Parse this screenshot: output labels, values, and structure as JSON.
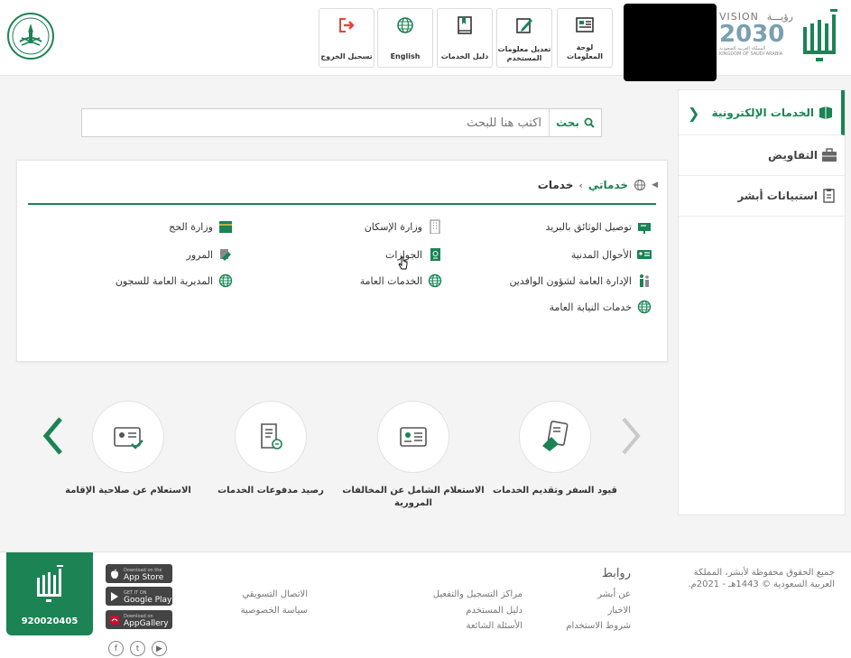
{
  "header": {
    "buttons": [
      {
        "label": "لوحة المعلومات",
        "icon": "dashboard-icon"
      },
      {
        "label": "تعديل معلومات المستخدم",
        "icon": "edit-user-icon"
      },
      {
        "label": "دليل الخدمات",
        "icon": "guide-book-icon"
      },
      {
        "label": "English",
        "icon": "globe-icon"
      },
      {
        "label": "تسجيل الخروج",
        "icon": "logout-icon"
      }
    ],
    "vision": {
      "top": "VISION",
      "arabic": "رؤيـــة",
      "year": "2030",
      "sub1": "المملكة العربية السعودية",
      "sub2": "KINGDOM OF SAUDI ARABIA"
    },
    "logo_text": "أبشر"
  },
  "sidebar": {
    "items": [
      {
        "label": "الخدمات الإلكترونية",
        "icon": "eservices-icon"
      },
      {
        "label": "التفاويض",
        "icon": "briefcase-icon"
      },
      {
        "label": "استبيانات أبشر",
        "icon": "survey-icon"
      }
    ]
  },
  "search": {
    "placeholder": "اكتب هنا للبحث",
    "button": "بحث"
  },
  "breadcrumb": {
    "mine": "خدماتي",
    "current": "خدمات"
  },
  "services": {
    "col1": [
      {
        "label": "توصيل الوثائق بالبريد",
        "icon": "mailbox-icon"
      },
      {
        "label": "الأحوال المدنية",
        "icon": "id-card-icon"
      },
      {
        "label": "الإدارة العامة لشؤون الوافدين",
        "icon": "people-icon"
      },
      {
        "label": "خدمات النيابة العامة",
        "icon": "globe-icon"
      }
    ],
    "col2": [
      {
        "label": "وزارة الإسكان",
        "icon": "building-icon"
      },
      {
        "label": "الجوازات",
        "icon": "passport-icon"
      },
      {
        "label": "الخدمات العامة",
        "icon": "globe-icon"
      }
    ],
    "col3": [
      {
        "label": "وزارة الحج",
        "icon": "kaaba-icon"
      },
      {
        "label": "المرور",
        "icon": "traffic-icon"
      },
      {
        "label": "المديرية العامة للسجون",
        "icon": "globe-icon"
      }
    ]
  },
  "carousel": [
    {
      "label": "قيود السفر وتقديم الخدمات",
      "icon": "travel-doc-icon"
    },
    {
      "label": "الاستعلام الشامل عن المخالفات المرورية",
      "icon": "id-card-icon"
    },
    {
      "label": "رصيد مدفوعات الخدمات",
      "icon": "receipt-icon"
    },
    {
      "label": "الاستعلام عن صلاحية الإقامة",
      "icon": "residency-check-icon"
    }
  ],
  "footer": {
    "copyright": "جميع الحقوق محفوظة لأبشر، المملكة العربية السعودية © 1443هـ - 2021م.",
    "links_title": "روابط",
    "col1": [
      "عن أبشر",
      "الاخبار",
      "شروط الاستخدام"
    ],
    "col2": [
      "مراكز التسجيل والتفعيل",
      "دليل المستخدم",
      "الأسئلة الشائعة"
    ],
    "col3": [
      "الاتصال التسويقي",
      "سياسة الخصوصية"
    ],
    "stores": [
      {
        "small": "Download on the",
        "big": "App Store",
        "icon": "apple-icon"
      },
      {
        "small": "GET IT ON",
        "big": "Google Play",
        "icon": "google-play-icon"
      },
      {
        "small": "Download on",
        "big": "AppGallery",
        "icon": "huawei-icon"
      }
    ],
    "phone": "920020405",
    "social": [
      "f",
      "t",
      "▶"
    ]
  },
  "colors": {
    "brand": "#1b8354",
    "arrow_inactive": "#c9c9c9"
  }
}
